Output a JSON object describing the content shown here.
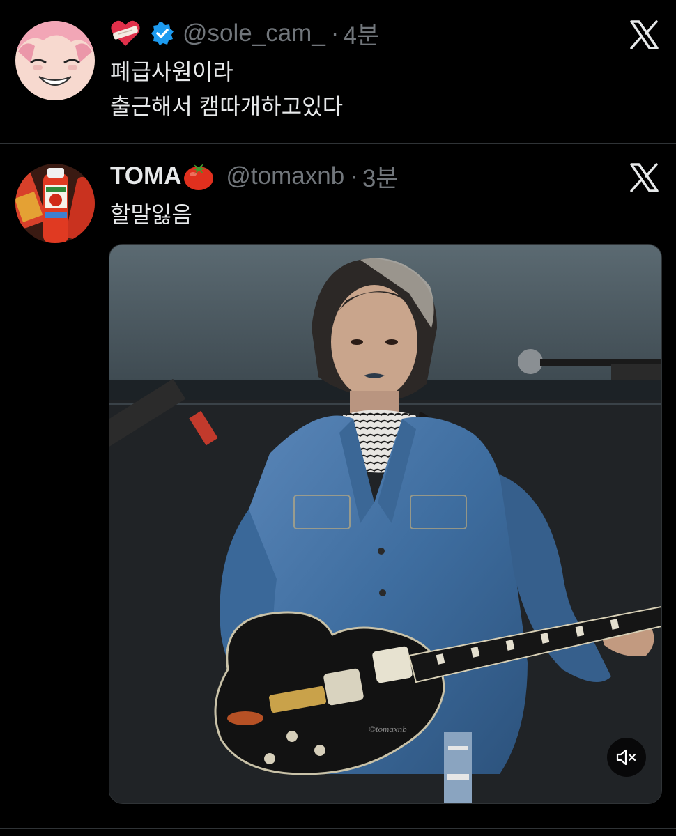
{
  "tweets": [
    {
      "name_emoji": "heart-with-bandage-emoji",
      "verified": true,
      "handle": "@sole_cam_",
      "separator": "·",
      "time": "4분",
      "lines": [
        "폐급사원이라",
        "출근해서 캠따개하고있다"
      ],
      "avatar_icon": "anime-face-avatar"
    },
    {
      "name": "TOMA",
      "name_emoji": "tomato-emoji",
      "handle": "@tomaxnb",
      "separator": "·",
      "time": "3분",
      "lines": [
        "할말잃음"
      ],
      "avatar_icon": "tomato-juice-avatar",
      "media": {
        "type": "video",
        "watermark": "©tomaxnb",
        "mute_icon": "volume-muted-icon"
      }
    }
  ],
  "icons": {
    "platform": "x-logo-icon",
    "verified": "verified-badge-icon"
  },
  "colors": {
    "background": "#000000",
    "verified_blue": "#1d9bf0",
    "secondary_text": "#71767b"
  }
}
